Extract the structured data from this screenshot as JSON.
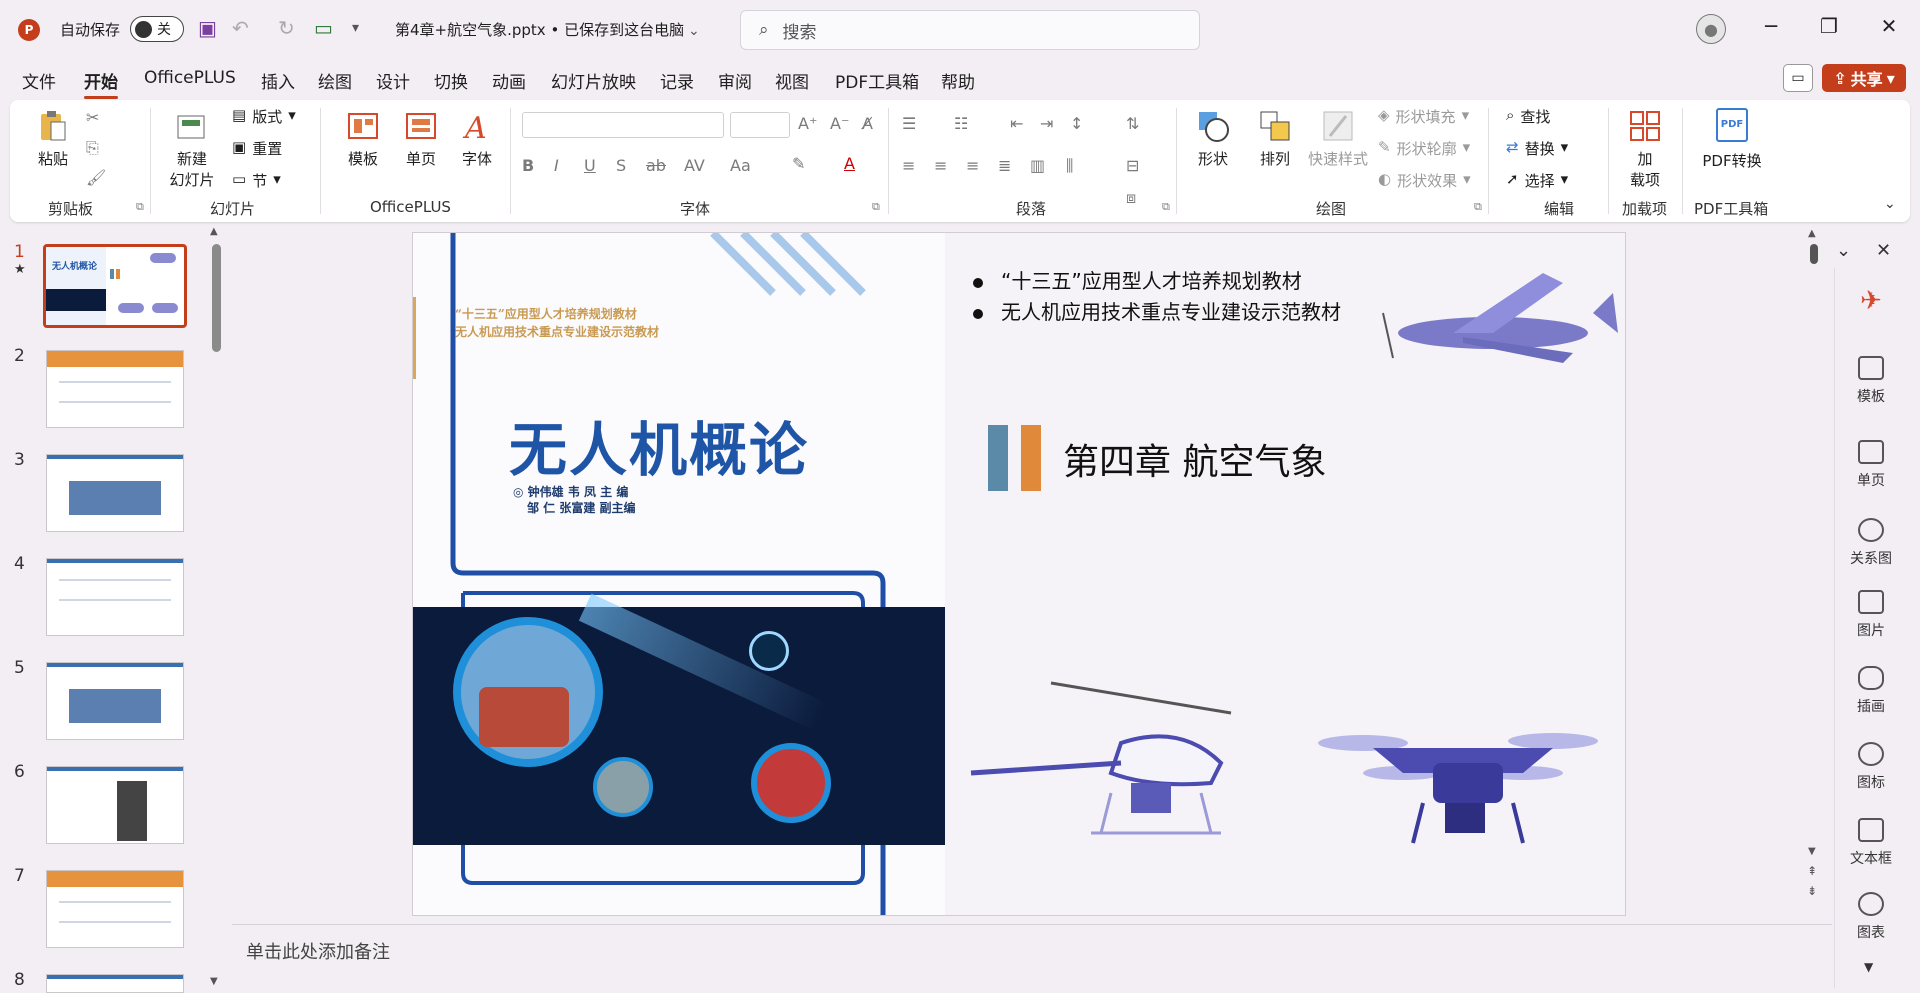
{
  "titlebar": {
    "app_logo": "P",
    "autosave_label": "自动保存",
    "autosave_state": "关",
    "document_title": "第4章+航空气象.pptx • 已保存到这台电脑",
    "search_placeholder": "搜索"
  },
  "menu": {
    "items": [
      "文件",
      "开始",
      "OfficePLUS",
      "插入",
      "绘图",
      "设计",
      "切换",
      "动画",
      "幻灯片放映",
      "记录",
      "审阅",
      "视图",
      "PDF工具箱",
      "帮助"
    ],
    "active": "开始",
    "share_label": "共享"
  },
  "ribbon": {
    "clipboard": {
      "paste": "粘贴",
      "group": "剪贴板"
    },
    "slides": {
      "new_slide_line1": "新建",
      "new_slide_line2": "幻灯片",
      "layout": "版式",
      "reset": "重置",
      "section": "节",
      "group": "幻灯片"
    },
    "officeplus": {
      "template": "模板",
      "single_page": "单页",
      "font": "字体",
      "group": "OfficePLUS"
    },
    "font": {
      "group": "字体",
      "bold": "B",
      "italic": "I",
      "underline": "U",
      "shadow": "S",
      "strike": "ab",
      "spacing": "AV",
      "case": "Aa"
    },
    "paragraph": {
      "group": "段落"
    },
    "drawing": {
      "shape": "形状",
      "arrange": "排列",
      "quick_styles": "快速样式",
      "fill": "形状填充",
      "outline": "形状轮廓",
      "effects": "形状效果",
      "group": "绘图"
    },
    "editing": {
      "find": "查找",
      "replace": "替换",
      "select": "选择",
      "group": "编辑"
    },
    "addins": {
      "line1": "加",
      "line2": "载项",
      "group": "加载项"
    },
    "pdf": {
      "convert": "PDF转换",
      "group": "PDF工具箱",
      "icon_text": "PDF"
    }
  },
  "thumbnails": [
    {
      "num": "1",
      "kind": "cover",
      "selected": true,
      "title": "无人机概论"
    },
    {
      "num": "2",
      "kind": "band"
    },
    {
      "num": "3",
      "kind": "table"
    },
    {
      "num": "4",
      "kind": "lines"
    },
    {
      "num": "5",
      "kind": "table"
    },
    {
      "num": "6",
      "kind": "lines"
    },
    {
      "num": "7",
      "kind": "band"
    },
    {
      "num": "8",
      "kind": "band"
    }
  ],
  "slide": {
    "cover": {
      "subtitle_line1": "“十三五”应用型人才培养规划教材",
      "subtitle_line2": "无人机应用技术重点专业建设示范教材",
      "title": "无人机概论",
      "authors_line1": "◎ 钟伟雄  韦  凤   主  编",
      "authors_line2": "邹   仁  张富建   副主编"
    },
    "bullets": [
      "“十三五”应用型人才培养规划教材",
      "无人机应用技术重点专业建设示范教材"
    ],
    "chapter_title": "第四章  航空气象",
    "accent_colors": [
      "#5a8aa8",
      "#e0893b"
    ]
  },
  "notes_placeholder": "单击此处添加备注",
  "side_panel": {
    "items": [
      "模板",
      "单页",
      "关系图",
      "图片",
      "插画",
      "图标",
      "文本框",
      "图表"
    ]
  }
}
